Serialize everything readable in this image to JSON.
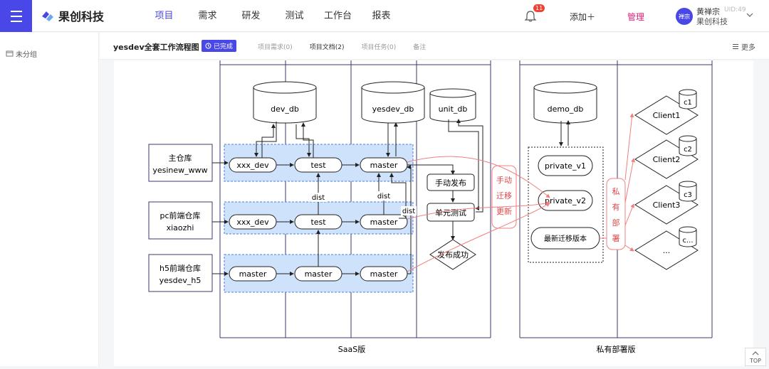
{
  "app": {
    "logo_text": "果创科技",
    "nav": [
      "项目",
      "需求",
      "研发",
      "测试",
      "工作台",
      "报表"
    ],
    "active_nav": "项目",
    "notification_count": "11",
    "add_label": "添加＋",
    "manage_label": "管理",
    "user": {
      "avatar_text": "禅宗",
      "name": "黄禅宗",
      "uid": "UID:49",
      "company": "果创科技"
    }
  },
  "sidebar": {
    "items": [
      {
        "label": "未分组"
      }
    ]
  },
  "doc": {
    "title": "yesdev全套工作流程图",
    "status": "已完成",
    "tabs": [
      "项目需求(0)",
      "项目文档(2)",
      "项目任务(0)",
      "备注"
    ],
    "active_tab": "项目文档(2)",
    "more_label": "更多"
  },
  "diagram": {
    "repos": [
      {
        "name": "主仓库",
        "sub": "yesinew_www"
      },
      {
        "name": "pc前端仓库",
        "sub": "xiaozhi"
      },
      {
        "name": "h5前端仓库",
        "sub": "yesdev_h5"
      }
    ],
    "databases": {
      "dev": "dev_db",
      "yesdev": "yesdev_db",
      "unit": "unit_db",
      "demo": "demo_db"
    },
    "row1": [
      "xxx_dev",
      "test",
      "master"
    ],
    "row2": [
      "xxx_dev",
      "test",
      "master"
    ],
    "row3": [
      "master",
      "master",
      "master"
    ],
    "dist_labels": [
      "dist",
      "dist",
      "dist"
    ],
    "saas_steps": [
      "手动发布",
      "单元测试",
      "发布成功"
    ],
    "migrate_note": [
      "手动",
      "迁移",
      "更新"
    ],
    "private_versions": [
      "private_v1",
      "private_v2",
      "最新迁移版本"
    ],
    "deploy_note": [
      "私",
      "有",
      "部",
      "署"
    ],
    "clients": [
      {
        "label": "Client1",
        "db": "c1"
      },
      {
        "label": "Client2",
        "db": "c2"
      },
      {
        "label": "Client3",
        "db": "c3"
      },
      {
        "label": "...",
        "db": "c..."
      }
    ],
    "section_labels": {
      "saas": "SaaS版",
      "private": "私有部署版"
    }
  },
  "top_label": "TOP",
  "colors": {
    "accent": "#4a47e8",
    "highlight": "#cfe2fb",
    "arrow_red": "#f08080"
  }
}
